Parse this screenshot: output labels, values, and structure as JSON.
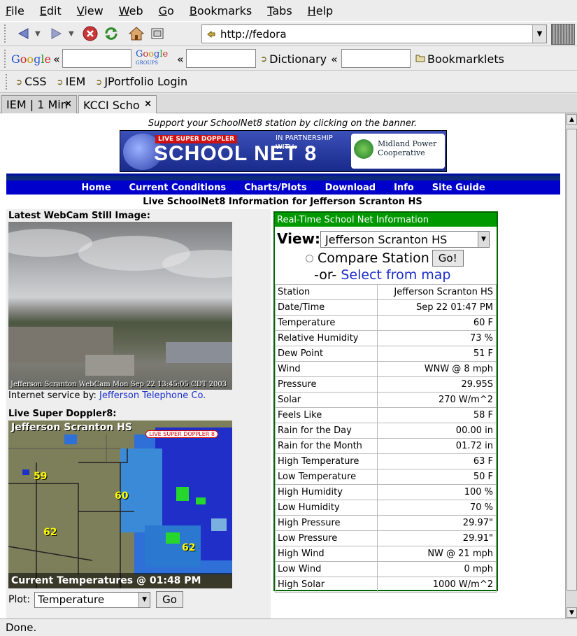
{
  "menu": [
    "File",
    "Edit",
    "View",
    "Web",
    "Go",
    "Bookmarks",
    "Tabs",
    "Help"
  ],
  "url": "http://fedora",
  "search_toolbar": {
    "google": "Google",
    "google_groups": "Google Groups",
    "dictionary": "Dictionary",
    "bookmarklets": "Bookmarklets"
  },
  "bookmarks": [
    "CSS",
    "IEM",
    "JPortfolio Login"
  ],
  "tabs": [
    {
      "label": "IEM | 1 Min",
      "active": false
    },
    {
      "label": "KCCI Scho",
      "active": true
    }
  ],
  "status": "Done.",
  "page": {
    "support_text": "Support your SchoolNet8 station by clicking on the banner.",
    "banner": {
      "tag": "LIVE SUPER DOPPLER",
      "name": "SCHOOL NET 8",
      "partnership": "IN PARTNERSHIP WITH:",
      "partner_line1": "Midland Power",
      "partner_line2": "Cooperative"
    },
    "site_nav": [
      "Home",
      "Current Conditions",
      "Charts/Plots",
      "Download",
      "Info",
      "Site Guide"
    ],
    "subtitle": "Live SchoolNet8 Information for Jefferson Scranton HS",
    "webcam_heading": "Latest WebCam Still Image:",
    "webcam_caption": "Jefferson Scranton WebCam Mon Sep 22 13:45:05 CDT 2003",
    "isp_prefix": "Internet service by:",
    "isp_link": "Jefferson Telephone Co.",
    "radar_heading": "Live Super Doppler8:",
    "radar_title": "Jefferson Scranton HS",
    "radar_logo": "LIVE SUPER DOPPLER 8",
    "radar_footer": "Current Temperatures @ 01:48 PM",
    "radar_temps": [
      "59",
      "60",
      "62",
      "62"
    ],
    "plot_label": "Plot:",
    "plot_value": "Temperature",
    "plot_go": "Go",
    "rt_header": "Real-Time School Net Information",
    "view_label": "View:",
    "view_value": "Jefferson Scranton HS",
    "compare_label": "Compare Station",
    "compare_go": "Go!",
    "or_text": "-or-",
    "map_link": "Select from map",
    "observations": [
      [
        "Station",
        "Jefferson Scranton HS"
      ],
      [
        "Date/Time",
        "Sep 22 01:47 PM"
      ],
      [
        "Temperature",
        "60 F"
      ],
      [
        "Relative Humidity",
        "73 %"
      ],
      [
        "Dew Point",
        "51 F"
      ],
      [
        "Wind",
        "WNW @ 8 mph"
      ],
      [
        "Pressure",
        "29.95S"
      ],
      [
        "Solar",
        "270 W/m^2"
      ],
      [
        "Feels Like",
        "58 F"
      ],
      [
        "Rain for the Day",
        "00.00 in"
      ],
      [
        "Rain for the Month",
        "01.72 in"
      ],
      [
        "High Temperature",
        "63 F"
      ],
      [
        "Low Temperature",
        "50 F"
      ],
      [
        "High Humidity",
        "100 %"
      ],
      [
        "Low Humidity",
        "70 %"
      ],
      [
        "High Pressure",
        "29.97\""
      ],
      [
        "Low Pressure",
        "29.91\""
      ],
      [
        "High Wind",
        "NW @ 21 mph"
      ],
      [
        "Low Wind",
        "0 mph"
      ],
      [
        "High Solar",
        "1000 W/m^2"
      ]
    ]
  }
}
